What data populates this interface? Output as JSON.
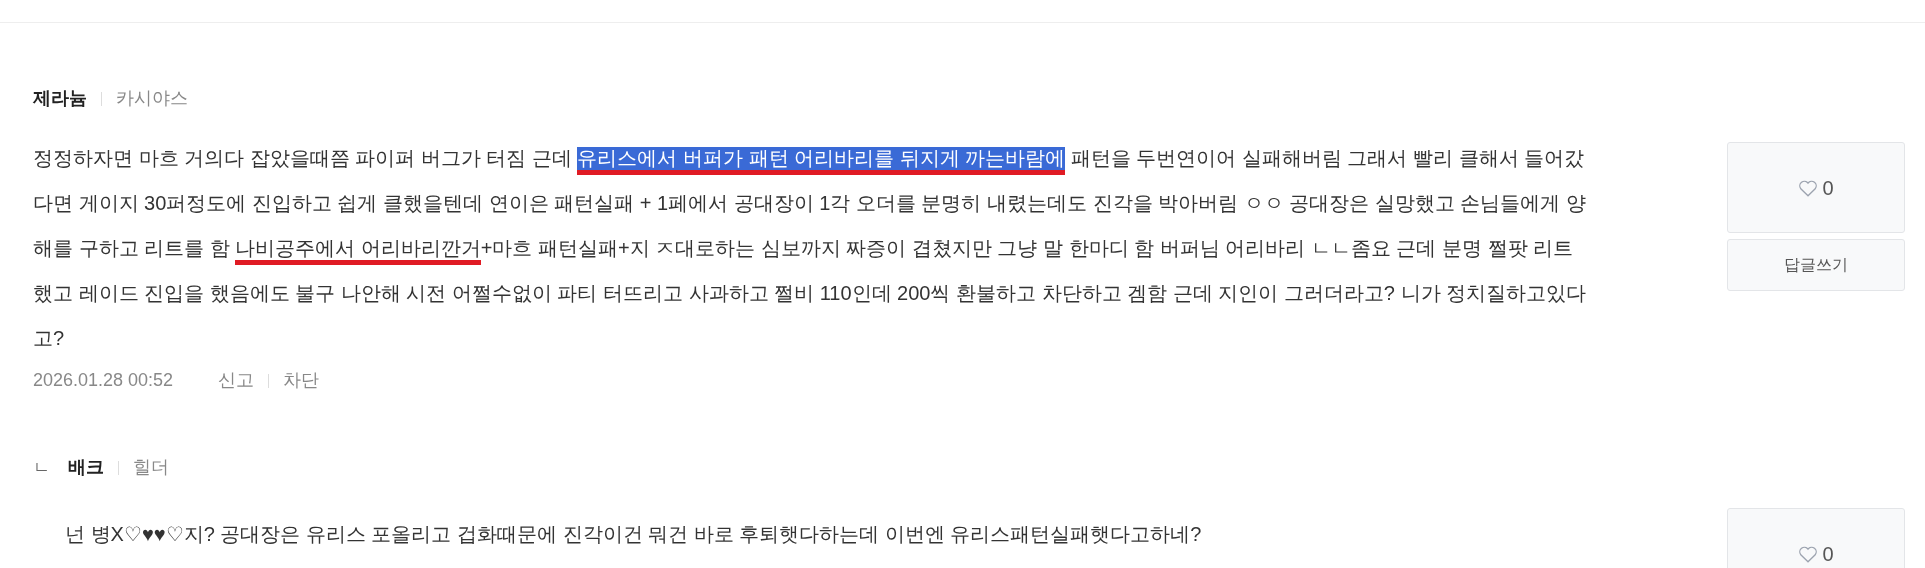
{
  "comments": [
    {
      "author": "제라늄",
      "job": "카시야스",
      "body": [
        {
          "text": "정정하자면 마흐 거의다 잡았을때쯤 파이퍼 버그가 터짐 근데 "
        },
        {
          "text": "유리스에서 버퍼가 패턴 어리바리를 뒤지게 까는바람에",
          "highlighted": true,
          "marked": true
        },
        {
          "text": " 패턴을 두번연이어 실패해버림 그래서 빨리 클해서 들어갔다면 게이지 30퍼정도에 진입하고 쉽게 클했을텐데 연이은 패턴실패 + 1페에서 공대장이 1각 오더를 분명히 내렸는데도 진각을 박아버림 ㅇㅇ 공대장은 실망했고 손님들에게 양해를 구하고 리트를 함 "
        },
        {
          "text": "나비공주에서 어리바리깐거",
          "marked": true
        },
        {
          "text": "+마흐 패턴실패+지 ㅈ대로하는 심보까지 짜증이 겹쳤지만 그냥 말 한마디 함 버퍼님 어리바리 ㄴㄴ좀요 근데 분명 쩔팟 리트했고 레이드 진입을 했음에도 불구 나안해 시전 어쩔수없이 파티 터뜨리고 사과하고 쩔비 110인데 200씩 환불하고 차단하고 겜함 근데 지인이 그러더라고? 니가 정치질하고있다고?"
        }
      ],
      "date": "2026.01.28 00:52",
      "actions": [
        "신고",
        "차단"
      ],
      "likes": "0",
      "reply_button": "답글쓰기"
    },
    {
      "author": "배크",
      "job": "힐더",
      "reply_mark": "ㄴ",
      "body": [
        {
          "text": "넌 병X♡♥♥♡지? 공대장은 유리스 포올리고 겁화때문에 진각이건 뭐건 바로 후퇴햇다하는데 이번엔 유리스패턴실패햇다고하네?"
        }
      ],
      "likes": "0"
    }
  ]
}
